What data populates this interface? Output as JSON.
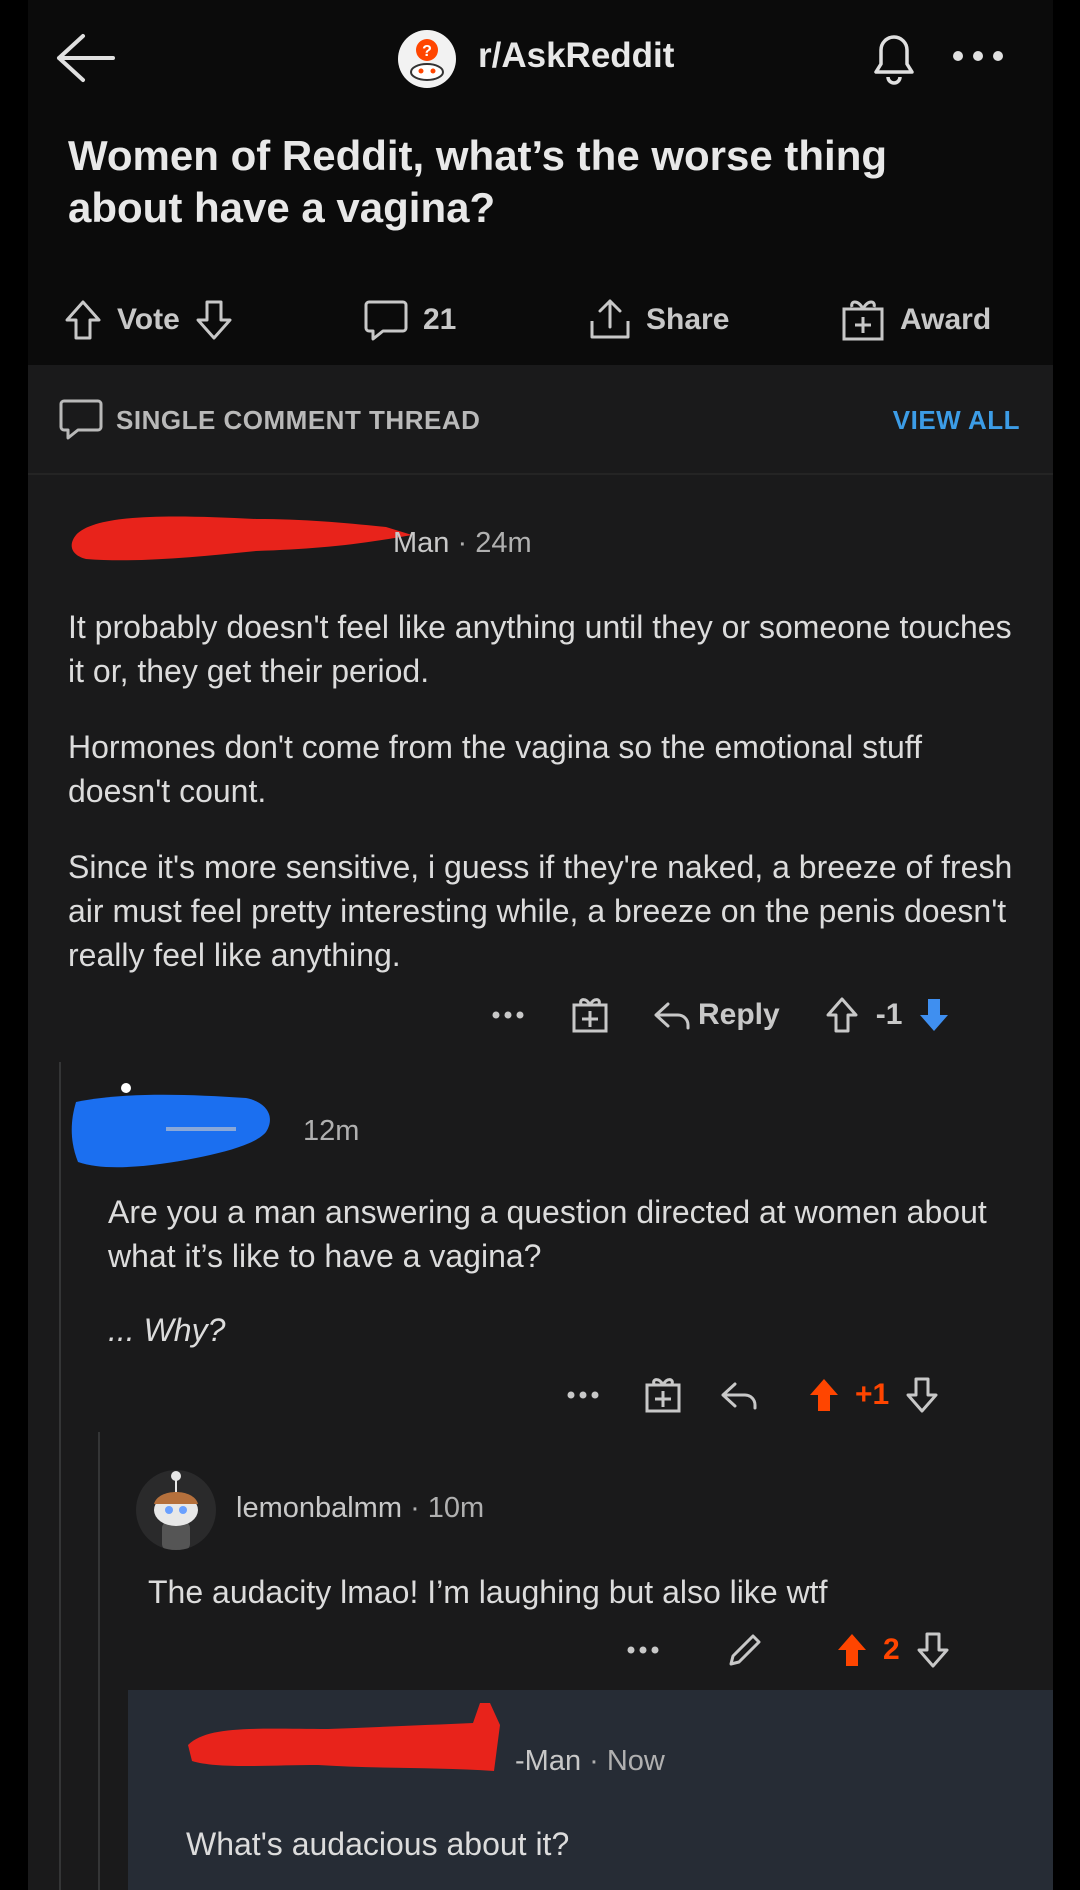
{
  "header": {
    "subreddit": "r/AskReddit"
  },
  "post": {
    "title": "Women of Reddit, what’s the worse thing about have a vagina?",
    "vote_label": "Vote",
    "comment_count": "21",
    "share_label": "Share",
    "award_label": "Award"
  },
  "thread_bar": {
    "label": "SINGLE COMMENT THREAD",
    "view_all": "VIEW ALL"
  },
  "comments": [
    {
      "username_suffix": "Man",
      "time": "24m",
      "paragraphs": [
        "It probably doesn't feel like anything until they or someone touches it or, they get their period.",
        "Hormones don't come from the vagina so the emotional stuff doesn't count.",
        "Since it's more sensitive, i guess if they're naked, a breeze of fresh air must feel pretty interesting while, a breeze on the penis doesn't really feel like anything."
      ],
      "reply_label": "Reply",
      "score": "-1"
    },
    {
      "time": "12m",
      "paragraphs": [
        "Are you a man answering a question directed at women about what it’s like to have a vagina?",
        "... Why?"
      ],
      "score": "+1"
    },
    {
      "username": "lemonbalmm",
      "time": "10m",
      "body": "The audacity lmao! I’m laughing but also like wtf",
      "score": "2"
    },
    {
      "username_suffix": "-Man",
      "time": "Now",
      "body": "What's audacious about it?"
    }
  ],
  "colors": {
    "background": "#1a1a1b",
    "link_blue": "#3c9ce6",
    "upvote_orange": "#ff4500",
    "downvote_blue": "#3f8ff0",
    "redact_red": "#e8231b",
    "redact_blue": "#1b6ff0"
  }
}
